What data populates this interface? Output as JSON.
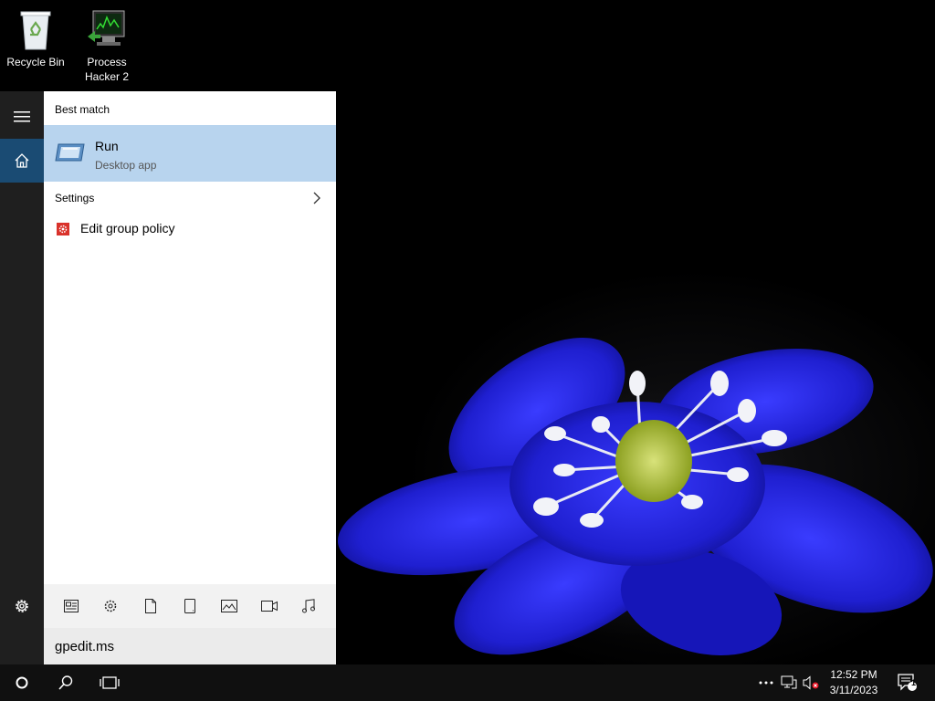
{
  "desktop": {
    "icons": [
      {
        "label": "Recycle Bin"
      },
      {
        "label_line1": "Process",
        "label_line2": "Hacker 2"
      }
    ]
  },
  "start_rail": {
    "items": [
      {
        "icon": "hamburger-menu-icon"
      },
      {
        "icon": "home-icon"
      },
      {
        "icon": "gear-icon"
      }
    ]
  },
  "search": {
    "best_match_header": "Best match",
    "best_match": {
      "title": "Run",
      "subtitle": "Desktop app",
      "icon": "run-app-icon"
    },
    "settings_header": "Settings",
    "settings_items": [
      {
        "label": "Edit group policy",
        "icon": "group-policy-icon"
      }
    ],
    "filters": [
      "apps-filter-icon",
      "settings-filter-icon",
      "documents-filter-icon",
      "device-filter-icon",
      "photos-filter-icon",
      "videos-filter-icon",
      "music-filter-icon"
    ],
    "query": "gpedit.ms"
  },
  "taskbar": {
    "time": "12:52 PM",
    "date": "3/11/2023",
    "notification_count": "1"
  },
  "colors": {
    "accent_selected": "#b8d4ee",
    "rail_active": "#1a4b73",
    "taskbar": "#101010"
  }
}
